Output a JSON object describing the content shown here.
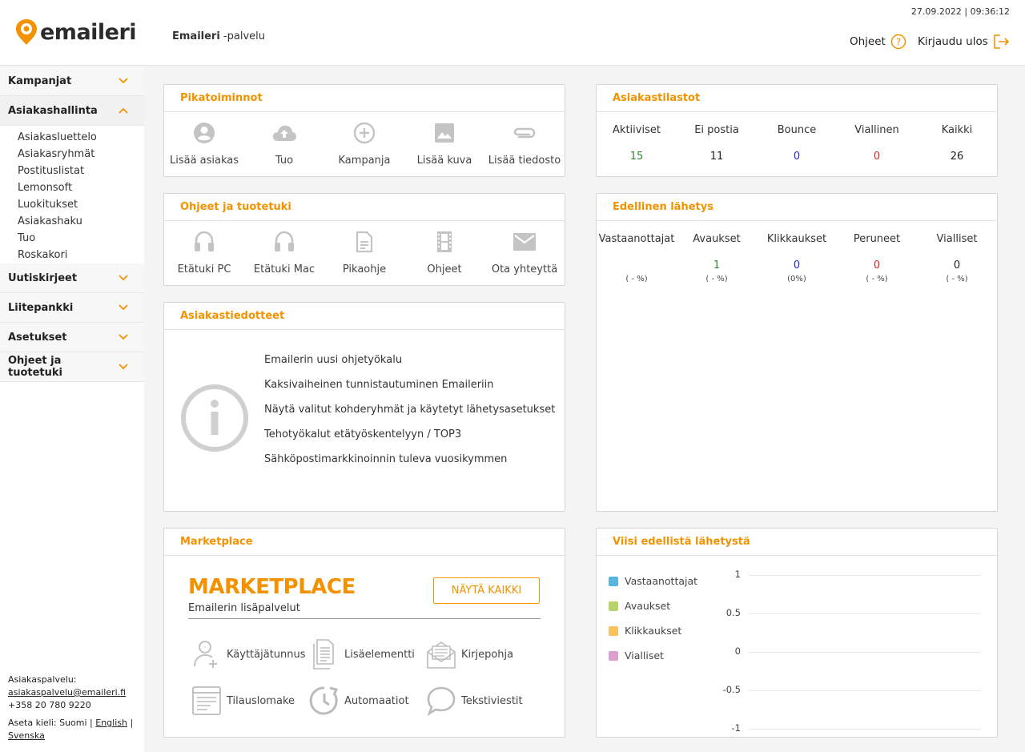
{
  "header": {
    "logo_text": "emaileri",
    "service_bold": "Emaileri",
    "service_rest": " -palvelu",
    "timestamp": "27.09.2022 | 09:36:12",
    "help_label": "Ohjeet",
    "logout_label": "Kirjaudu ulos",
    "accent": "#f39200"
  },
  "sidebar": {
    "sections": [
      {
        "label": "Kampanjat",
        "open": false
      },
      {
        "label": "Asiakashallinta",
        "open": true
      },
      {
        "label": "Uutiskirjeet",
        "open": false
      },
      {
        "label": "Liitepankki",
        "open": false
      },
      {
        "label": "Asetukset",
        "open": false
      },
      {
        "label": "Ohjeet ja tuotetuki",
        "open": false
      }
    ],
    "sub_items": [
      "Asiakasluettelo",
      "Asiakasryhmät",
      "Postituslistat",
      "Lemonsoft",
      "Luokitukset",
      "Asiakashaku",
      "Tuo",
      "Roskakori"
    ],
    "footer": {
      "label": "Asiakaspalvelu:",
      "email": "asiakaspalvelu@emaileri.fi",
      "phone": "+358 20 780 9220",
      "lang_prefix": "Aseta kieli: Suomi |",
      "lang_en": "English",
      "lang_sep": "|",
      "lang_sv": "Svenska"
    }
  },
  "quick_actions": {
    "title": "Pikatoiminnot",
    "items": [
      {
        "label": "Lisää asiakas",
        "icon": "person-icon"
      },
      {
        "label": "Tuo",
        "icon": "cloud-upload-icon"
      },
      {
        "label": "Kampanja",
        "icon": "plus-circle-icon"
      },
      {
        "label": "Lisää kuva",
        "icon": "image-icon"
      },
      {
        "label": "Lisää tiedosto",
        "icon": "paperclip-icon"
      }
    ]
  },
  "support": {
    "title": "Ohjeet ja tuotetuki",
    "items": [
      {
        "label": "Etätuki PC",
        "icon": "headset-icon"
      },
      {
        "label": "Etätuki Mac",
        "icon": "headset-icon"
      },
      {
        "label": "Pikaohje",
        "icon": "document-icon"
      },
      {
        "label": "Ohjeet",
        "icon": "film-icon"
      },
      {
        "label": "Ota yhteyttä",
        "icon": "envelope-icon"
      }
    ]
  },
  "notices": {
    "title": "Asiakastiedotteet",
    "items": [
      "Emailerin uusi ohjetyökalu",
      "Kaksivaiheinen tunnistautuminen Emaileriin",
      "Näytä valitut kohderyhmät ja käytetyt lähetysasetukset",
      "Tehotyökalut etätyöskentelyyn / TOP3",
      "Sähköpostimarkkinoinnin tuleva vuosikymmen"
    ]
  },
  "marketplace": {
    "title": "Marketplace",
    "heading": "MARKETPLACE",
    "subheading": "Emailerin lisäpalvelut",
    "button": "NÄYTÄ KAIKKI",
    "items": [
      {
        "label": "Käyttäjätunnus",
        "icon": "add-user-icon"
      },
      {
        "label": "Lisäelementti",
        "icon": "documents-icon"
      },
      {
        "label": "Kirjepohja",
        "icon": "mail-template-icon"
      },
      {
        "label": "Tilauslomake",
        "icon": "form-icon"
      },
      {
        "label": "Automaatiot",
        "icon": "clock-cycle-icon"
      },
      {
        "label": "Tekstiviestit",
        "icon": "chat-bubble-icon"
      }
    ]
  },
  "customer_stats": {
    "title": "Asiakastilastot",
    "columns": [
      {
        "label": "Aktiiviset",
        "value": "15",
        "color": "#2e8b2e"
      },
      {
        "label": "Ei postia",
        "value": "11",
        "color": "#222222"
      },
      {
        "label": "Bounce",
        "value": "0",
        "color": "#2a2ad0"
      },
      {
        "label": "Viallinen",
        "value": "0",
        "color": "#d02a2a"
      },
      {
        "label": "Kaikki",
        "value": "26",
        "color": "#222222"
      }
    ]
  },
  "last_send": {
    "title": "Edellinen lähetys",
    "columns": [
      {
        "label": "Vastaanottajat",
        "value": "",
        "sub": "( - %)",
        "color": "#222222"
      },
      {
        "label": "Avaukset",
        "value": "1",
        "sub": "( - %)",
        "color": "#2e8b2e"
      },
      {
        "label": "Klikkaukset",
        "value": "0",
        "sub": "(0%)",
        "color": "#2a2ad0"
      },
      {
        "label": "Peruneet",
        "value": "0",
        "sub": "( - %)",
        "color": "#d02a2a"
      },
      {
        "label": "Vialliset",
        "value": "0",
        "sub": "( - %)",
        "color": "#222222"
      }
    ]
  },
  "last_five": {
    "title": "Viisi edellistä lähetystä",
    "legend": [
      {
        "label": "Vastaanottajat",
        "color": "#5ab4e0"
      },
      {
        "label": "Avaukset",
        "color": "#b5d46a"
      },
      {
        "label": "Klikkaukset",
        "color": "#f7c25c"
      },
      {
        "label": "Vialliset",
        "color": "#d9a0d0"
      }
    ]
  },
  "chart_data": {
    "type": "line",
    "series": [
      {
        "name": "Vastaanottajat",
        "values": []
      },
      {
        "name": "Avaukset",
        "values": []
      },
      {
        "name": "Klikkaukset",
        "values": []
      },
      {
        "name": "Vialliset",
        "values": []
      }
    ],
    "ylim": [
      -1,
      1
    ],
    "yticks": [
      "1",
      "0.5",
      "0",
      "-0.5",
      "-1"
    ],
    "legend": "left",
    "grid": true
  }
}
